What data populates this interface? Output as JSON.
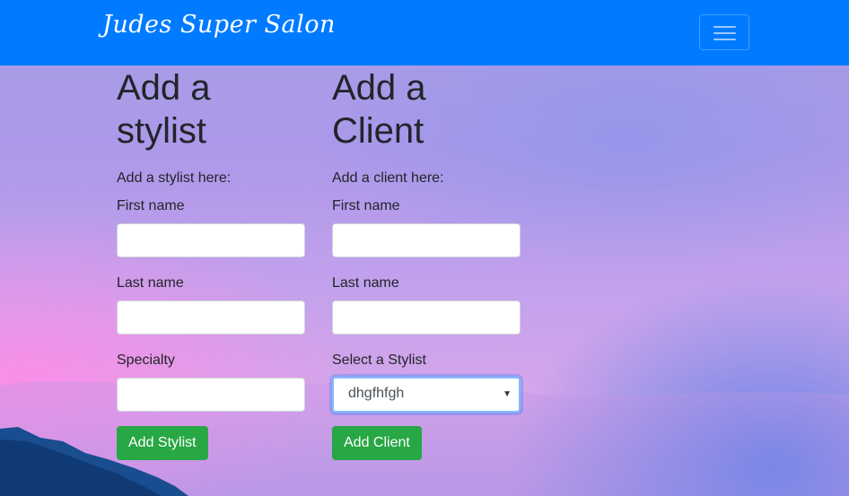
{
  "navbar": {
    "brand": "Judes Super Salon",
    "toggler_icon": "hamburger-menu-icon",
    "color": "#007bff"
  },
  "stylist_form": {
    "heading": "Add a stylist",
    "lead": "Add a stylist here:",
    "first_name_label": "First name",
    "first_name_value": "",
    "last_name_label": "Last name",
    "last_name_value": "",
    "specialty_label": "Specialty",
    "specialty_value": "",
    "submit_label": "Add Stylist"
  },
  "client_form": {
    "heading": "Add a Client",
    "lead": "Add a client here:",
    "first_name_label": "First name",
    "first_name_value": "",
    "last_name_label": "Last name",
    "last_name_value": "",
    "stylist_select_label": "Select a Stylist",
    "stylist_select_value": "dhgfhfgh",
    "submit_label": "Add Client"
  },
  "colors": {
    "button": "#28a745",
    "focus_border": "#80bdff"
  }
}
